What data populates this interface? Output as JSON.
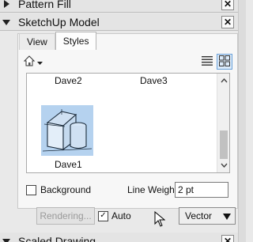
{
  "trays": {
    "pattern_fill": {
      "title": "Pattern Fill",
      "close": "✕"
    },
    "sketchup_model": {
      "title": "SketchUp Model",
      "close": "✕"
    },
    "scaled_drawing": {
      "title": "Scaled Drawing",
      "close": "✕"
    }
  },
  "tabs": [
    {
      "label": "View",
      "active": false
    },
    {
      "label": "Styles",
      "active": true
    }
  ],
  "toolbar": {
    "home_icon": "home-icon",
    "dropdown_icon": "chevron-down-icon",
    "list_view_icon": "list-view-icon",
    "thumbnail_view_icon": "thumbnail-view-icon"
  },
  "gallery": {
    "items": [
      {
        "name": "Dave2"
      },
      {
        "name": "Dave3"
      },
      {
        "name": "Dave1",
        "selected": true
      }
    ],
    "selected_color": "#b5d2ef"
  },
  "background": {
    "label": "Background",
    "checked": false
  },
  "line_weight": {
    "label": "Line Weight",
    "value": "2 pt"
  },
  "render": {
    "label": "Rendering...",
    "enabled": false
  },
  "auto": {
    "label": "Auto",
    "checked": true,
    "mark": "✓"
  },
  "render_mode": {
    "selected": "Vector"
  }
}
